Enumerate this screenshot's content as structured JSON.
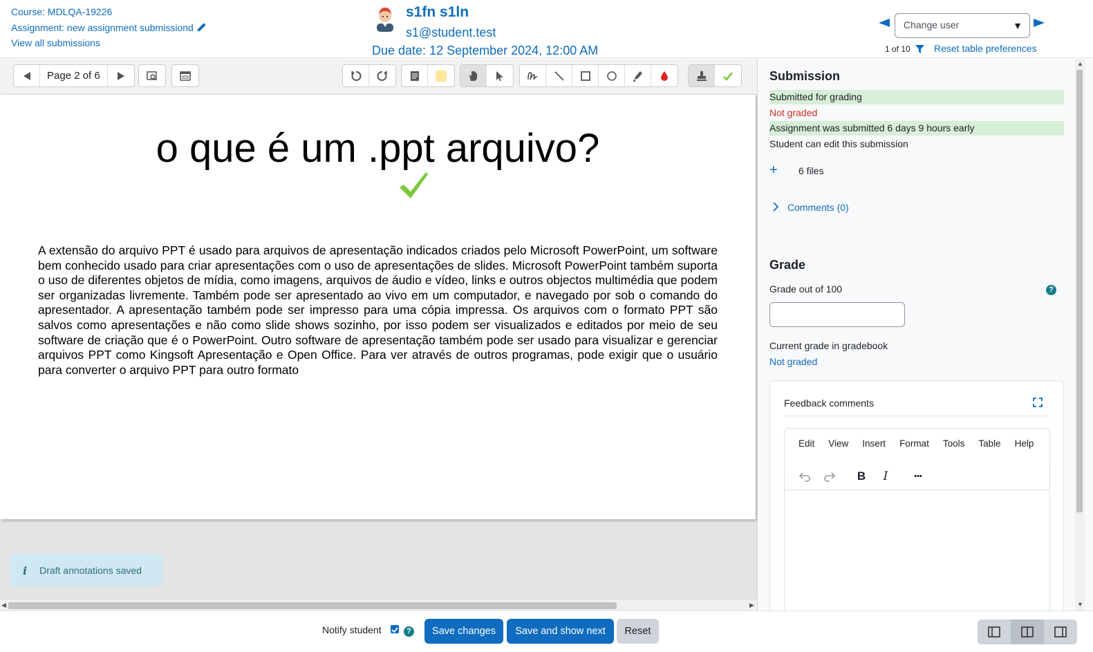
{
  "header": {
    "course_link": "Course: MDLQA-19226",
    "assignment_link": "Assignment: new assignment submissiond",
    "view_all": "View all submissions",
    "user_name": "s1fn s1ln",
    "user_email": "s1@student.test",
    "due_date": "Due date: 12 September 2024, 12:00 AM",
    "change_user_placeholder": "Change user",
    "user_position": "1 of 10",
    "reset_table": "Reset table preferences"
  },
  "toolbar": {
    "page_label": "Page 2 of 6",
    "icons": [
      "prev-page-icon",
      "next-page-icon",
      "search-comments-icon",
      "expand-comments-icon",
      "rotate-left-icon",
      "rotate-right-icon",
      "comment-icon",
      "comment-color-icon",
      "hand-icon",
      "select-icon",
      "pen-icon",
      "line-icon",
      "rectangle-icon",
      "oval-icon",
      "highlight-icon",
      "annotation-color-icon",
      "stamp-icon",
      "stamp-check-icon"
    ]
  },
  "document": {
    "title": "o que é um .ppt arquivo?",
    "body": "A extensão do arquivo PPT é usado para arquivos de apresentação indicados criados pelo Microsoft PowerPoint, um software bem conhecido usado para criar apresentações com o uso de apresentações de slides. Microsoft PowerPoint também suporta o uso de diferentes objetos de mídia, como imagens, arquivos de áudio e vídeo, links e outros objectos multimédia que podem ser organizadas livremente. Também pode ser apresentado ao vivo em um computador, e navegado por sob o comando do apresentador. A apresentação também pode ser impresso para uma cópia impressa. Os arquivos com o formato PPT são salvos como apresentações e não como slide shows sozinho, por isso podem ser visualizados e editados por meio de seu software de criação que é o PowerPoint. Outro software de apresentação também pode ser usado para visualizar e gerenciar arquivos PPT como Kingsoft Apresentação e Open Office. Para ver através de outros programas, pode exigir que o usuário para converter o arquivo PPT para outro formato"
  },
  "toast": {
    "icon": "i",
    "text": "Draft annotations saved"
  },
  "submission": {
    "heading": "Submission",
    "status": "Submitted for grading",
    "grading_status": "Not graded",
    "timing": "Assignment was submitted 6 days 9 hours early",
    "edit": "Student can edit this submission",
    "files_toggle": "+",
    "files": "6 files",
    "comments": "Comments (0)"
  },
  "grade": {
    "heading": "Grade",
    "label": "Grade out of 100",
    "help": "?",
    "value": "",
    "current_label": "Current grade in gradebook",
    "current_value": "Not graded"
  },
  "feedback": {
    "title": "Feedback comments",
    "menu": [
      "Edit",
      "View",
      "Insert",
      "Format",
      "Tools",
      "Table",
      "Help"
    ],
    "more": "•••"
  },
  "footer": {
    "notify_label": "Notify student",
    "notify_checked": true,
    "help": "?",
    "save": "Save changes",
    "save_next": "Save and show next",
    "reset": "Reset"
  },
  "colors": {
    "link": "#0f6cbf",
    "not_graded": "#ca3120",
    "success_bg": "#d7eed7",
    "check_green": "#7cc93b"
  }
}
